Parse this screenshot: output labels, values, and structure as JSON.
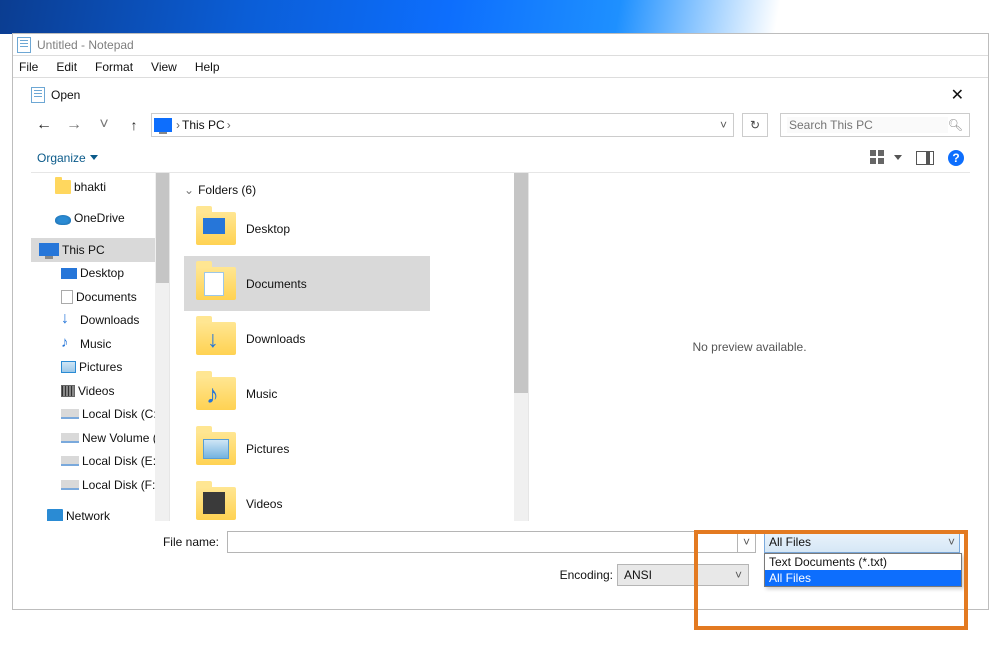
{
  "app": {
    "title": "Untitled - Notepad"
  },
  "menubar": {
    "items": [
      "File",
      "Edit",
      "Format",
      "View",
      "Help"
    ]
  },
  "dialog": {
    "title": "Open",
    "breadcrumb": "This PC",
    "search_placeholder": "Search This PC",
    "organize_label": "Organize",
    "sections_header": "Folders (6)",
    "preview_text": "No preview available.",
    "file_name_label": "File name:",
    "file_name_value": "",
    "encoding_label": "Encoding:",
    "encoding_value": "ANSI",
    "filetype_selected": "All Files",
    "filetype_options": [
      "Text Documents (*.txt)",
      "All Files"
    ]
  },
  "sidebar": {
    "items": [
      {
        "label": "bhakti",
        "icon": "folder"
      },
      {
        "label": "OneDrive",
        "icon": "onedrive"
      },
      {
        "label": "This PC",
        "icon": "pc",
        "selected": true
      },
      {
        "label": "Desktop",
        "icon": "desktop"
      },
      {
        "label": "Documents",
        "icon": "doc"
      },
      {
        "label": "Downloads",
        "icon": "download"
      },
      {
        "label": "Music",
        "icon": "music"
      },
      {
        "label": "Pictures",
        "icon": "pictures"
      },
      {
        "label": "Videos",
        "icon": "video"
      },
      {
        "label": "Local Disk (C:)",
        "icon": "disk"
      },
      {
        "label": "New Volume (D:)",
        "icon": "disk",
        "truncated": "New Volume (D:"
      },
      {
        "label": "Local Disk (E:)",
        "icon": "disk"
      },
      {
        "label": "Local Disk (F:)",
        "icon": "disk"
      },
      {
        "label": "Network",
        "icon": "net"
      }
    ]
  },
  "folders": [
    {
      "label": "Desktop",
      "icon": "desktop"
    },
    {
      "label": "Documents",
      "icon": "doc",
      "selected": true
    },
    {
      "label": "Downloads",
      "icon": "dl"
    },
    {
      "label": "Music",
      "icon": "music"
    },
    {
      "label": "Pictures",
      "icon": "pics"
    },
    {
      "label": "Videos",
      "icon": "video"
    }
  ]
}
